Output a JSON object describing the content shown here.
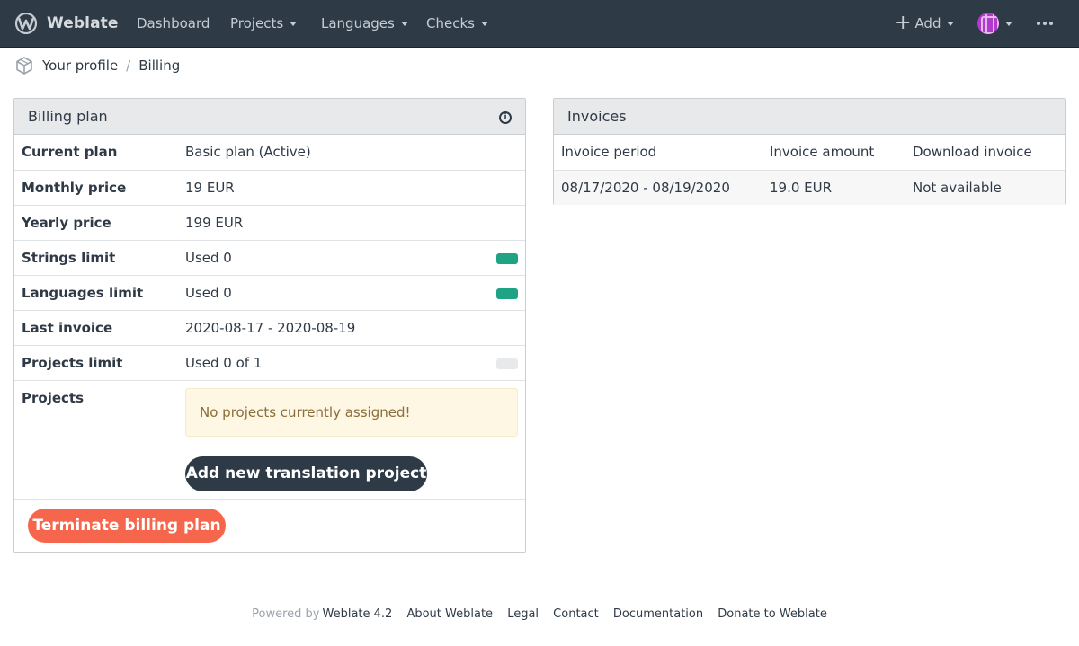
{
  "navbar": {
    "brand": "Weblate",
    "items": [
      "Dashboard",
      "Projects",
      "Languages",
      "Checks"
    ],
    "add_label": "Add"
  },
  "breadcrumb": [
    "Your profile",
    "Billing"
  ],
  "billing": {
    "title": "Billing plan",
    "rows": [
      {
        "key": "Current plan",
        "value": "Basic plan (Active)"
      },
      {
        "key": "Monthly price",
        "value": "19 EUR"
      },
      {
        "key": "Yearly price",
        "value": "199 EUR"
      },
      {
        "key": "Strings limit",
        "value": "Used 0"
      },
      {
        "key": "Languages limit",
        "value": "Used 0"
      },
      {
        "key": "Last invoice",
        "value": "2020-08-17 - 2020-08-19"
      },
      {
        "key": "Projects limit",
        "value": "Used 0 of 1"
      }
    ],
    "limit_fill": {
      "strings": 1.0,
      "languages": 1.0,
      "projects": 0.0
    },
    "projects_label": "Projects",
    "no_projects": "No projects currently assigned!",
    "add_project_button": "Add new translation project",
    "terminate_button": "Terminate billing plan"
  },
  "invoices": {
    "title": "Invoices",
    "headers": [
      "Invoice period",
      "Invoice amount",
      "Download invoice"
    ],
    "rows": [
      [
        "08/17/2020 - 08/19/2020",
        "19.0 EUR",
        "Not available"
      ]
    ]
  },
  "footer": {
    "powered_by": "Powered by",
    "version": "Weblate 4.2",
    "links": [
      "About Weblate",
      "Legal",
      "Contact",
      "Documentation",
      "Donate to Weblate"
    ]
  },
  "colors": {
    "navbar": "#2e3a46",
    "accent_green": "#1fa385",
    "danger": "#f6664c",
    "avatar": "#b03ac9"
  }
}
